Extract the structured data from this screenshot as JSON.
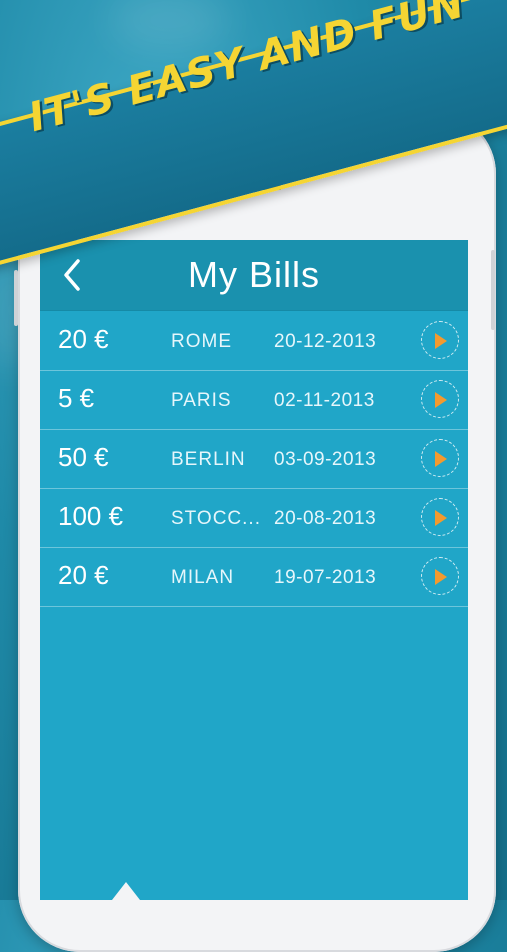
{
  "promo": {
    "headline": "IT'S EASY AND FUN"
  },
  "screen": {
    "title": "My Bills",
    "back_icon": "chevron-left-icon"
  },
  "bills": [
    {
      "amount": "20 €",
      "city": "ROME",
      "date": "20-12-2013"
    },
    {
      "amount": "5 €",
      "city": "PARIS",
      "date": "02-11-2013"
    },
    {
      "amount": "50 €",
      "city": "BERLIN",
      "date": "03-09-2013"
    },
    {
      "amount": "100 €",
      "city": "STOCC...",
      "date": "20-08-2013"
    },
    {
      "amount": "20 €",
      "city": "MILAN",
      "date": "19-07-2013"
    }
  ],
  "colors": {
    "accent_yellow": "#f5d533",
    "screen_bg": "#20a6c8",
    "navbar_bg": "#1a91ae",
    "arrow_orange": "#f39a2e"
  }
}
